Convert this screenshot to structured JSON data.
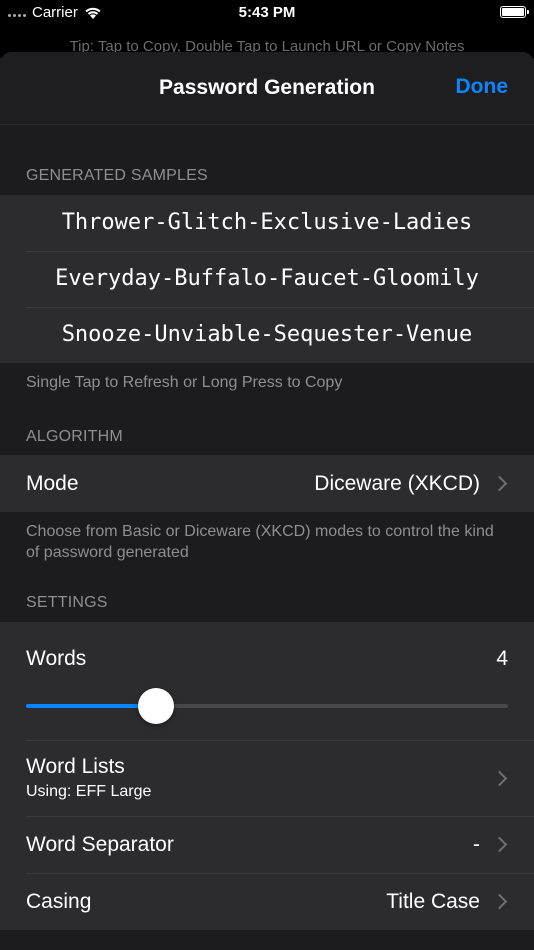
{
  "status_bar": {
    "carrier": "Carrier",
    "time": "5:43 PM"
  },
  "background_tip": "Tip: Tap to Copy, Double Tap to Launch URL or Copy Notes",
  "nav": {
    "title": "Password Generation",
    "done_label": "Done"
  },
  "samples": {
    "header": "GENERATED SAMPLES",
    "items": [
      "Thrower-Glitch-Exclusive-Ladies",
      "Everyday-Buffalo-Faucet-Gloomily",
      "Snooze-Unviable-Sequester-Venue"
    ],
    "footer": "Single Tap to Refresh or Long Press to Copy"
  },
  "algorithm": {
    "header": "ALGORITHM",
    "mode_label": "Mode",
    "mode_value": "Diceware (XKCD)",
    "footer": "Choose from Basic or Diceware (XKCD) modes to control the kind of password generated"
  },
  "settings": {
    "header": "SETTINGS",
    "words_label": "Words",
    "words_value": "4",
    "words_slider_fraction": 0.27,
    "word_lists_label": "Word Lists",
    "word_lists_sub": "Using: EFF Large",
    "separator_label": "Word Separator",
    "separator_value": "-",
    "casing_label": "Casing",
    "casing_value": "Title Case"
  },
  "colors": {
    "accent": "#0a84ff",
    "background": "#1c1c1e",
    "cell": "#2c2c2e",
    "secondary_text": "#8e8e93"
  }
}
